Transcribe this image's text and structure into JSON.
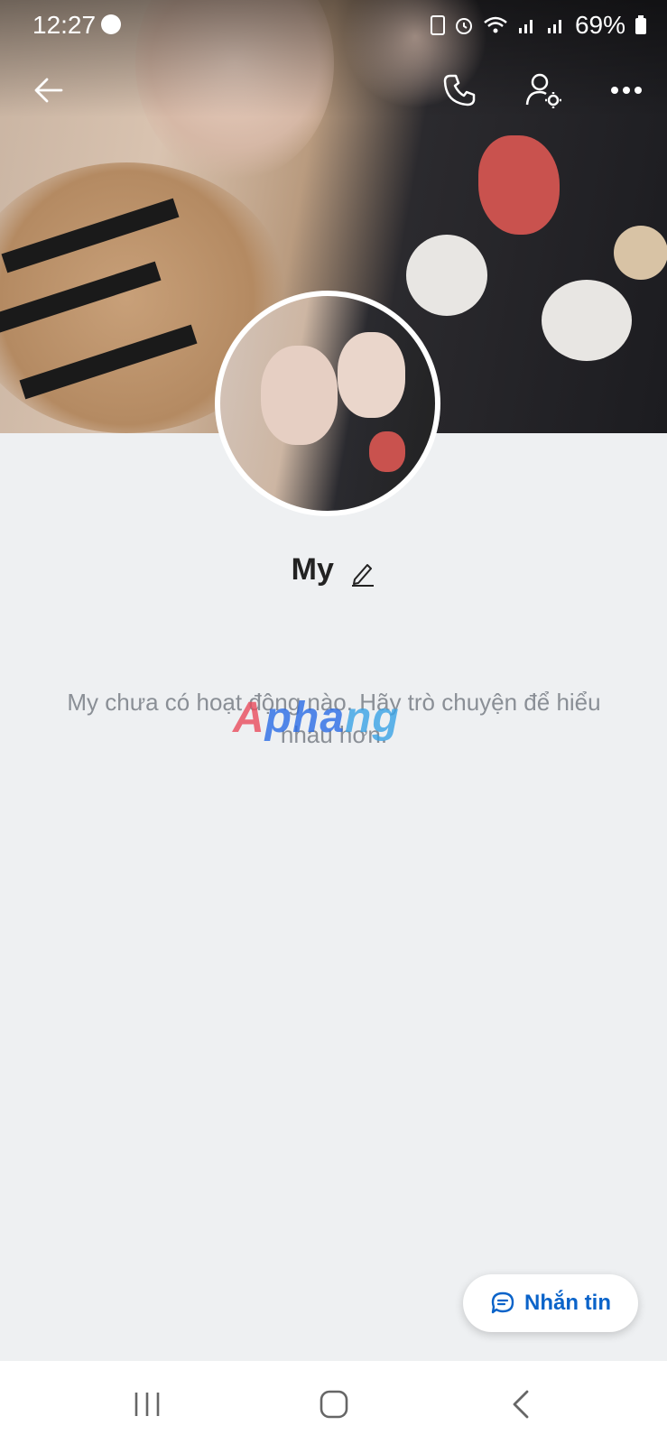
{
  "status_bar": {
    "time": "12:27",
    "battery": "69%"
  },
  "header": {
    "back_icon": "arrow-left-icon",
    "call_icon": "phone-icon",
    "settings_icon": "user-settings-icon",
    "more_icon": "more-horizontal-icon"
  },
  "profile": {
    "name": "My",
    "edit_icon": "pencil-icon"
  },
  "empty_state": {
    "message": "My chưa có hoạt động nào. Hãy trò chuyện để hiểu nhau hơn."
  },
  "watermark": {
    "part1": "A",
    "part2": "pha",
    "part3": "ng"
  },
  "message_button": {
    "label": "Nhắn tin",
    "icon": "chat-bubble-icon"
  },
  "colors": {
    "accent": "#0a63c9",
    "background": "#eef0f2"
  },
  "nav_bar": {
    "recent_icon": "recent-apps-icon",
    "home_icon": "home-icon",
    "back_icon": "back-icon"
  }
}
